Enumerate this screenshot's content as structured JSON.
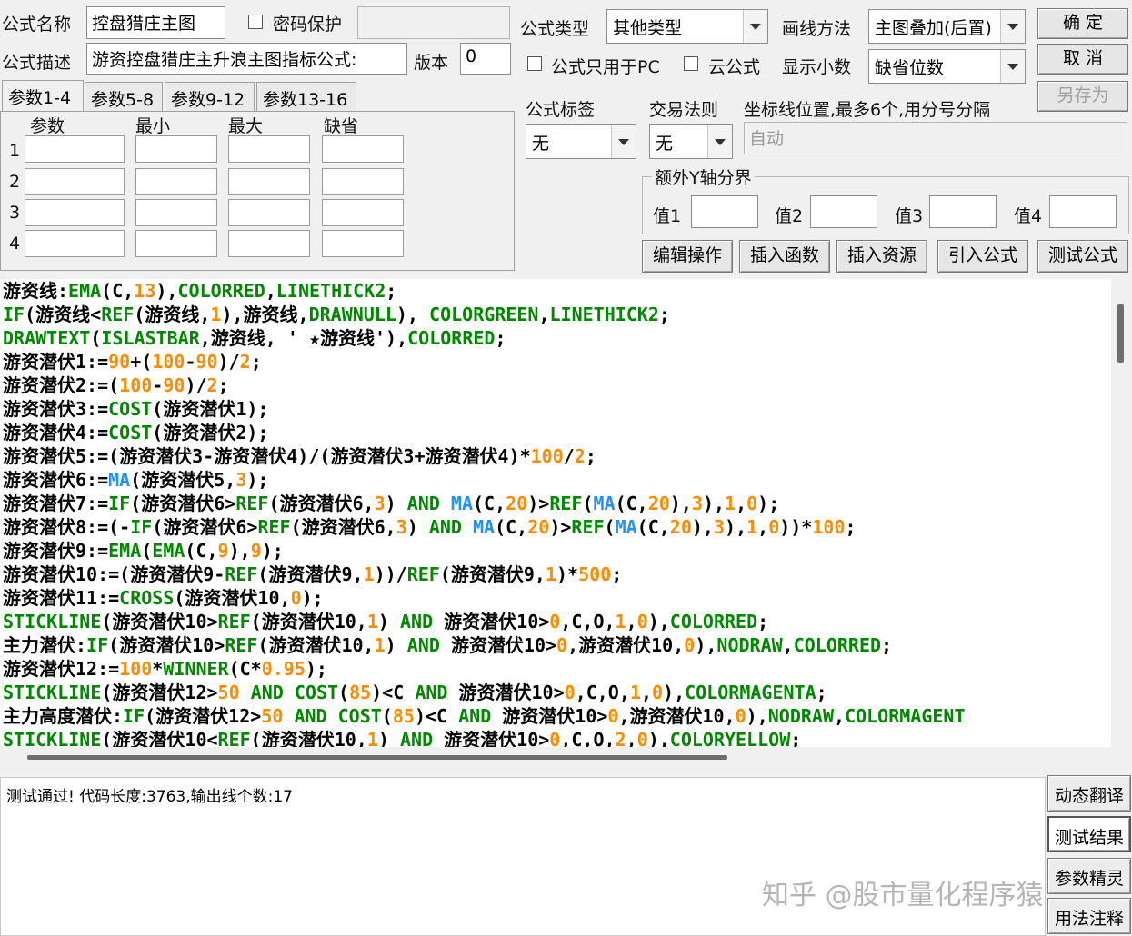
{
  "form": {
    "name_label": "公式名称",
    "name_value": "控盘猎庄主图",
    "password_label": "密码保护",
    "password_value": "",
    "desc_label": "公式描述",
    "desc_value": "游资控盘猎庄主升浪主图指标公式:",
    "version_label": "版本",
    "version_value": "0",
    "type_label": "公式类型",
    "type_value": "其他类型",
    "draw_label": "画线方法",
    "draw_value": "主图叠加(后置)",
    "pc_only_label": "公式只用于PC",
    "cloud_label": "云公式",
    "decimal_label": "显示小数",
    "decimal_value": "缺省位数",
    "tag_label": "公式标签",
    "tag_value": "无",
    "trade_label": "交易法则",
    "trade_value": "无",
    "coord_label": "坐标线位置,最多6个,用分号分隔",
    "coord_value": "自动",
    "yaxis_label": "额外Y轴分界",
    "value_labels": [
      "值1",
      "值2",
      "值3",
      "值4"
    ]
  },
  "buttons": {
    "ok": "确  定",
    "cancel": "取  消",
    "save_as": "另存为",
    "edit_ops": "编辑操作",
    "insert_func": "插入函数",
    "insert_res": "插入资源",
    "import_formula": "引入公式",
    "test_formula": "测试公式"
  },
  "params": {
    "tabs": [
      "参数1-4",
      "参数5-8",
      "参数9-12",
      "参数13-16"
    ],
    "headers": [
      "参数",
      "最小",
      "最大",
      "缺省"
    ],
    "rows": [
      "1",
      "2",
      "3",
      "4"
    ]
  },
  "code_lines": [
    [
      [
        "游资线:",
        "#000000"
      ],
      [
        "EMA",
        "#008800"
      ],
      [
        "(C,",
        "#000000"
      ],
      [
        "13",
        "#ff8c00"
      ],
      [
        "),",
        "#000000"
      ],
      [
        "COLORRED",
        "#008800"
      ],
      [
        ",",
        "#000000"
      ],
      [
        "LINETHICK2",
        "#008800"
      ],
      [
        ";",
        "#000000"
      ]
    ],
    [
      [
        "IF",
        "#008800"
      ],
      [
        "(游资线<",
        "#000000"
      ],
      [
        "REF",
        "#008800"
      ],
      [
        "(游资线,",
        "#000000"
      ],
      [
        "1",
        "#ff8c00"
      ],
      [
        "),游资线,",
        "#000000"
      ],
      [
        "DRAWNULL",
        "#008800"
      ],
      [
        "), ",
        "#000000"
      ],
      [
        "COLORGREEN",
        "#008800"
      ],
      [
        ",",
        "#000000"
      ],
      [
        "LINETHICK2",
        "#008800"
      ],
      [
        ";",
        "#000000"
      ]
    ],
    [
      [
        "DRAWTEXT",
        "#008800"
      ],
      [
        "(",
        "#000000"
      ],
      [
        "ISLASTBAR",
        "#008800"
      ],
      [
        ",游资线, ' ★游资线'),",
        "#000000"
      ],
      [
        "COLORRED",
        "#008800"
      ],
      [
        ";",
        "#000000"
      ]
    ],
    [
      [
        "游资潜伏1:=",
        "#000000"
      ],
      [
        "90",
        "#ff8c00"
      ],
      [
        "+(",
        "#000000"
      ],
      [
        "100",
        "#ff8c00"
      ],
      [
        "-",
        "#000000"
      ],
      [
        "90",
        "#ff8c00"
      ],
      [
        ")/",
        "#000000"
      ],
      [
        "2",
        "#ff8c00"
      ],
      [
        ";",
        "#000000"
      ]
    ],
    [
      [
        "游资潜伏2:=(",
        "#000000"
      ],
      [
        "100",
        "#ff8c00"
      ],
      [
        "-",
        "#000000"
      ],
      [
        "90",
        "#ff8c00"
      ],
      [
        ")/",
        "#000000"
      ],
      [
        "2",
        "#ff8c00"
      ],
      [
        ";",
        "#000000"
      ]
    ],
    [
      [
        "游资潜伏3:=",
        "#000000"
      ],
      [
        "COST",
        "#008800"
      ],
      [
        "(游资潜伏1);",
        "#000000"
      ]
    ],
    [
      [
        "游资潜伏4:=",
        "#000000"
      ],
      [
        "COST",
        "#008800"
      ],
      [
        "(游资潜伏2);",
        "#000000"
      ]
    ],
    [
      [
        "游资潜伏5:=(游资潜伏3-游资潜伏4)/(游资潜伏3+游资潜伏4)*",
        "#000000"
      ],
      [
        "100",
        "#ff8c00"
      ],
      [
        "/",
        "#000000"
      ],
      [
        "2",
        "#ff8c00"
      ],
      [
        ";",
        "#000000"
      ]
    ],
    [
      [
        "游资潜伏6:=",
        "#000000"
      ],
      [
        "MA",
        "#1e90ff"
      ],
      [
        "(游资潜伏5,",
        "#000000"
      ],
      [
        "3",
        "#ff8c00"
      ],
      [
        ");",
        "#000000"
      ]
    ],
    [
      [
        "游资潜伏7:=",
        "#000000"
      ],
      [
        "IF",
        "#008800"
      ],
      [
        "(游资潜伏6>",
        "#000000"
      ],
      [
        "REF",
        "#008800"
      ],
      [
        "(游资潜伏6,",
        "#000000"
      ],
      [
        "3",
        "#ff8c00"
      ],
      [
        ") ",
        "#000000"
      ],
      [
        "AND",
        "#008800"
      ],
      [
        " ",
        "#000000"
      ],
      [
        "MA",
        "#1e90ff"
      ],
      [
        "(C,",
        "#000000"
      ],
      [
        "20",
        "#ff8c00"
      ],
      [
        ")>",
        "#000000"
      ],
      [
        "REF",
        "#008800"
      ],
      [
        "(",
        "#000000"
      ],
      [
        "MA",
        "#1e90ff"
      ],
      [
        "(C,",
        "#000000"
      ],
      [
        "20",
        "#ff8c00"
      ],
      [
        "),",
        "#000000"
      ],
      [
        "3",
        "#ff8c00"
      ],
      [
        "),",
        "#000000"
      ],
      [
        "1",
        "#ff8c00"
      ],
      [
        ",",
        "#000000"
      ],
      [
        "0",
        "#ff8c00"
      ],
      [
        ");",
        "#000000"
      ]
    ],
    [
      [
        "游资潜伏8:=(-",
        "#000000"
      ],
      [
        "IF",
        "#008800"
      ],
      [
        "(游资潜伏6>",
        "#000000"
      ],
      [
        "REF",
        "#008800"
      ],
      [
        "(游资潜伏6,",
        "#000000"
      ],
      [
        "3",
        "#ff8c00"
      ],
      [
        ") ",
        "#000000"
      ],
      [
        "AND",
        "#008800"
      ],
      [
        " ",
        "#000000"
      ],
      [
        "MA",
        "#1e90ff"
      ],
      [
        "(C,",
        "#000000"
      ],
      [
        "20",
        "#ff8c00"
      ],
      [
        ")>",
        "#000000"
      ],
      [
        "REF",
        "#008800"
      ],
      [
        "(",
        "#000000"
      ],
      [
        "MA",
        "#1e90ff"
      ],
      [
        "(C,",
        "#000000"
      ],
      [
        "20",
        "#ff8c00"
      ],
      [
        "),",
        "#000000"
      ],
      [
        "3",
        "#ff8c00"
      ],
      [
        "),",
        "#000000"
      ],
      [
        "1",
        "#ff8c00"
      ],
      [
        ",",
        "#000000"
      ],
      [
        "0",
        "#ff8c00"
      ],
      [
        "))*",
        "#000000"
      ],
      [
        "100",
        "#ff8c00"
      ],
      [
        ";",
        "#000000"
      ]
    ],
    [
      [
        "游资潜伏9:=",
        "#000000"
      ],
      [
        "EMA",
        "#008800"
      ],
      [
        "(",
        "#000000"
      ],
      [
        "EMA",
        "#008800"
      ],
      [
        "(C,",
        "#000000"
      ],
      [
        "9",
        "#ff8c00"
      ],
      [
        "),",
        "#000000"
      ],
      [
        "9",
        "#ff8c00"
      ],
      [
        ");",
        "#000000"
      ]
    ],
    [
      [
        "游资潜伏10:=(游资潜伏9-",
        "#000000"
      ],
      [
        "REF",
        "#008800"
      ],
      [
        "(游资潜伏9,",
        "#000000"
      ],
      [
        "1",
        "#ff8c00"
      ],
      [
        "))/",
        "#000000"
      ],
      [
        "REF",
        "#008800"
      ],
      [
        "(游资潜伏9,",
        "#000000"
      ],
      [
        "1",
        "#ff8c00"
      ],
      [
        ")*",
        "#000000"
      ],
      [
        "500",
        "#ff8c00"
      ],
      [
        ";",
        "#000000"
      ]
    ],
    [
      [
        "游资潜伏11:=",
        "#000000"
      ],
      [
        "CROSS",
        "#008800"
      ],
      [
        "(游资潜伏10,",
        "#000000"
      ],
      [
        "0",
        "#ff8c00"
      ],
      [
        ");",
        "#000000"
      ]
    ],
    [
      [
        "STICKLINE",
        "#008800"
      ],
      [
        "(游资潜伏10>",
        "#000000"
      ],
      [
        "REF",
        "#008800"
      ],
      [
        "(游资潜伏10,",
        "#000000"
      ],
      [
        "1",
        "#ff8c00"
      ],
      [
        ") ",
        "#000000"
      ],
      [
        "AND",
        "#008800"
      ],
      [
        " 游资潜伏10>",
        "#000000"
      ],
      [
        "0",
        "#ff8c00"
      ],
      [
        ",C,O,",
        "#000000"
      ],
      [
        "1",
        "#ff8c00"
      ],
      [
        ",",
        "#000000"
      ],
      [
        "0",
        "#ff8c00"
      ],
      [
        "),",
        "#000000"
      ],
      [
        "COLORRED",
        "#008800"
      ],
      [
        ";",
        "#000000"
      ]
    ],
    [
      [
        "主力潜伏:",
        "#000000"
      ],
      [
        "IF",
        "#008800"
      ],
      [
        "(游资潜伏10>",
        "#000000"
      ],
      [
        "REF",
        "#008800"
      ],
      [
        "(游资潜伏10,",
        "#000000"
      ],
      [
        "1",
        "#ff8c00"
      ],
      [
        ") ",
        "#000000"
      ],
      [
        "AND",
        "#008800"
      ],
      [
        " 游资潜伏10>",
        "#000000"
      ],
      [
        "0",
        "#ff8c00"
      ],
      [
        ",游资潜伏10,",
        "#000000"
      ],
      [
        "0",
        "#ff8c00"
      ],
      [
        "),",
        "#000000"
      ],
      [
        "NODRAW",
        "#008800"
      ],
      [
        ",",
        "#000000"
      ],
      [
        "COLORRED",
        "#008800"
      ],
      [
        ";",
        "#000000"
      ]
    ],
    [
      [
        "游资潜伏12:=",
        "#000000"
      ],
      [
        "100",
        "#ff8c00"
      ],
      [
        "*",
        "#000000"
      ],
      [
        "WINNER",
        "#008800"
      ],
      [
        "(C*",
        "#000000"
      ],
      [
        "0.95",
        "#ff8c00"
      ],
      [
        ");",
        "#000000"
      ]
    ],
    [
      [
        "STICKLINE",
        "#008800"
      ],
      [
        "(游资潜伏12>",
        "#000000"
      ],
      [
        "50",
        "#ff8c00"
      ],
      [
        " ",
        "#000000"
      ],
      [
        "AND",
        "#008800"
      ],
      [
        " ",
        "#000000"
      ],
      [
        "COST",
        "#008800"
      ],
      [
        "(",
        "#000000"
      ],
      [
        "85",
        "#ff8c00"
      ],
      [
        ")<C ",
        "#000000"
      ],
      [
        "AND",
        "#008800"
      ],
      [
        " 游资潜伏10>",
        "#000000"
      ],
      [
        "0",
        "#ff8c00"
      ],
      [
        ",C,O,",
        "#000000"
      ],
      [
        "1",
        "#ff8c00"
      ],
      [
        ",",
        "#000000"
      ],
      [
        "0",
        "#ff8c00"
      ],
      [
        "),",
        "#000000"
      ],
      [
        "COLORMAGENTA",
        "#008800"
      ],
      [
        ";",
        "#000000"
      ]
    ],
    [
      [
        "主力高度潜伏:",
        "#000000"
      ],
      [
        "IF",
        "#008800"
      ],
      [
        "(游资潜伏12>",
        "#000000"
      ],
      [
        "50",
        "#ff8c00"
      ],
      [
        " ",
        "#000000"
      ],
      [
        "AND",
        "#008800"
      ],
      [
        " ",
        "#000000"
      ],
      [
        "COST",
        "#008800"
      ],
      [
        "(",
        "#000000"
      ],
      [
        "85",
        "#ff8c00"
      ],
      [
        ")<C ",
        "#000000"
      ],
      [
        "AND",
        "#008800"
      ],
      [
        " 游资潜伏10>",
        "#000000"
      ],
      [
        "0",
        "#ff8c00"
      ],
      [
        ",游资潜伏10,",
        "#000000"
      ],
      [
        "0",
        "#ff8c00"
      ],
      [
        "),",
        "#000000"
      ],
      [
        "NODRAW",
        "#008800"
      ],
      [
        ",",
        "#000000"
      ],
      [
        "COLORMAGENT",
        "#008800"
      ]
    ],
    [
      [
        "STICKLINE",
        "#008800"
      ],
      [
        "(游资潜伏10<",
        "#000000"
      ],
      [
        "REF",
        "#008800"
      ],
      [
        "(游资潜伏10,",
        "#000000"
      ],
      [
        "1",
        "#ff8c00"
      ],
      [
        ") ",
        "#000000"
      ],
      [
        "AND",
        "#008800"
      ],
      [
        " 游资潜伏10>",
        "#000000"
      ],
      [
        "0",
        "#ff8c00"
      ],
      [
        ",C,O,",
        "#000000"
      ],
      [
        "2",
        "#ff8c00"
      ],
      [
        ",",
        "#000000"
      ],
      [
        "0",
        "#ff8c00"
      ],
      [
        "),",
        "#000000"
      ],
      [
        "COLORYELLOW",
        "#008800"
      ],
      [
        ";",
        "#000000"
      ]
    ]
  ],
  "output_text": "测试通过! 代码长度:3763,输出线个数:17",
  "side_buttons": [
    "动态翻译",
    "测试结果",
    "参数精灵",
    "用法注释"
  ],
  "watermark": "知乎 @股市量化程序猿"
}
